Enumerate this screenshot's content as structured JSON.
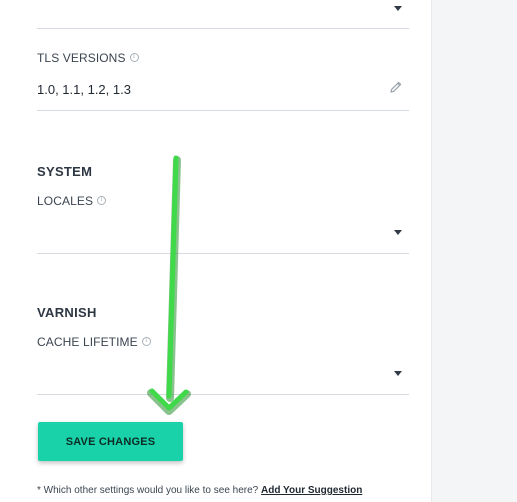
{
  "tls": {
    "label": "TLS VERSIONS",
    "value": "1.0, 1.1, 1.2, 1.3"
  },
  "system": {
    "title": "SYSTEM",
    "locales_label": "LOCALES",
    "locales_value": ""
  },
  "varnish": {
    "title": "VARNISH",
    "cache_lifetime_label": "CACHE LIFETIME",
    "cache_lifetime_value": ""
  },
  "actions": {
    "save_label": "SAVE CHANGES"
  },
  "footer": {
    "question": "* Which other settings would you like to see here?",
    "link_label": "Add Your Suggestion"
  },
  "colors": {
    "accent": "#19d2a9",
    "annotation_arrow": "#3fd94a"
  },
  "icons": {
    "info": "info-icon",
    "edit": "pencil-icon",
    "dropdown": "chevron-down-icon"
  }
}
